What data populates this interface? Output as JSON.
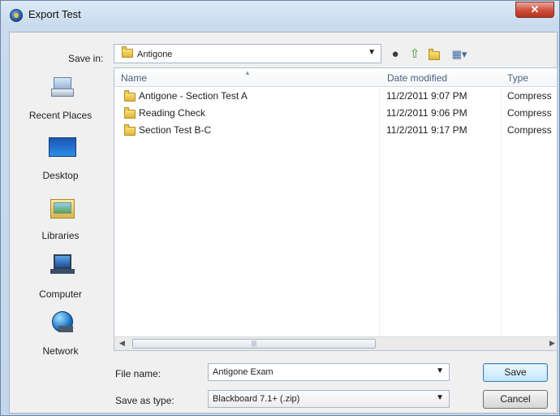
{
  "window": {
    "title": "Export Test",
    "close_label": "✕"
  },
  "toolbar": {
    "save_in_label": "Save in:",
    "save_in_value": "Antigone"
  },
  "places": [
    {
      "label": "Recent Places",
      "icon": "recent-places-icon"
    },
    {
      "label": "Desktop",
      "icon": "desktop-icon"
    },
    {
      "label": "Libraries",
      "icon": "libraries-icon"
    },
    {
      "label": "Computer",
      "icon": "computer-icon"
    },
    {
      "label": "Network",
      "icon": "network-icon"
    }
  ],
  "file_list": {
    "columns": [
      "Name",
      "Date modified",
      "Type"
    ],
    "rows": [
      {
        "name": "Antigone - Section Test A",
        "date": "11/2/2011 9:07 PM",
        "type": "Compress"
      },
      {
        "name": "Reading Check",
        "date": "11/2/2011 9:06 PM",
        "type": "Compress"
      },
      {
        "name": "Section Test B-C",
        "date": "11/2/2011 9:17 PM",
        "type": "Compress"
      }
    ]
  },
  "form": {
    "file_name_label": "File name:",
    "file_name_value": "Antigone Exam",
    "save_as_type_label": "Save as type:",
    "save_as_type_value": "Blackboard 7.1+ (.zip)"
  },
  "buttons": {
    "save": "Save",
    "cancel": "Cancel"
  }
}
